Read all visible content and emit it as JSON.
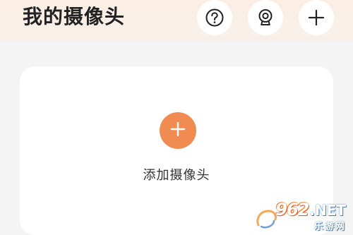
{
  "header": {
    "title": "我的摄像头",
    "buttons": [
      {
        "name": "help",
        "icon": "question-circle-icon"
      },
      {
        "name": "camera",
        "icon": "webcam-icon"
      },
      {
        "name": "add",
        "icon": "plus-icon"
      }
    ]
  },
  "main": {
    "add_camera_label": "添加摄像头",
    "add_icon": "plus-icon"
  },
  "watermark": {
    "number": "962",
    "domain": ".NET",
    "sub": "乐游网"
  },
  "colors": {
    "accent": "#f08b52",
    "header_bg": "#fbeee4",
    "page_bg": "#f4f4f4",
    "card_bg": "#ffffff",
    "text_primary": "#222222"
  }
}
